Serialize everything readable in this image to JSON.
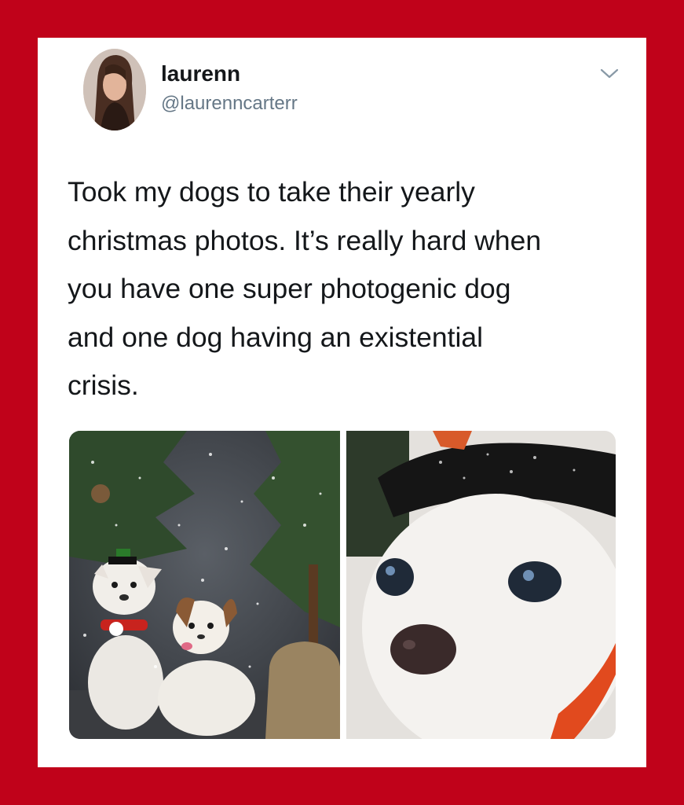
{
  "tweet": {
    "author_name": "laurenn",
    "author_handle": "@laurenncarterr",
    "text": "Took my dogs to take their yearly\nchristmas photos. It’s really hard when\nyou have one super photogenic dog\nand one dog having an existential\ncrisis.",
    "media": [
      {
        "description_icon": "photo-two-dogs-christmas"
      },
      {
        "description_icon": "photo-dog-closeup"
      }
    ]
  },
  "colors": {
    "frame": "#c0021a",
    "card": "#ffffff",
    "text": "#14171a",
    "handle": "#657786"
  },
  "icons": {
    "menu": "chevron-down-icon"
  }
}
